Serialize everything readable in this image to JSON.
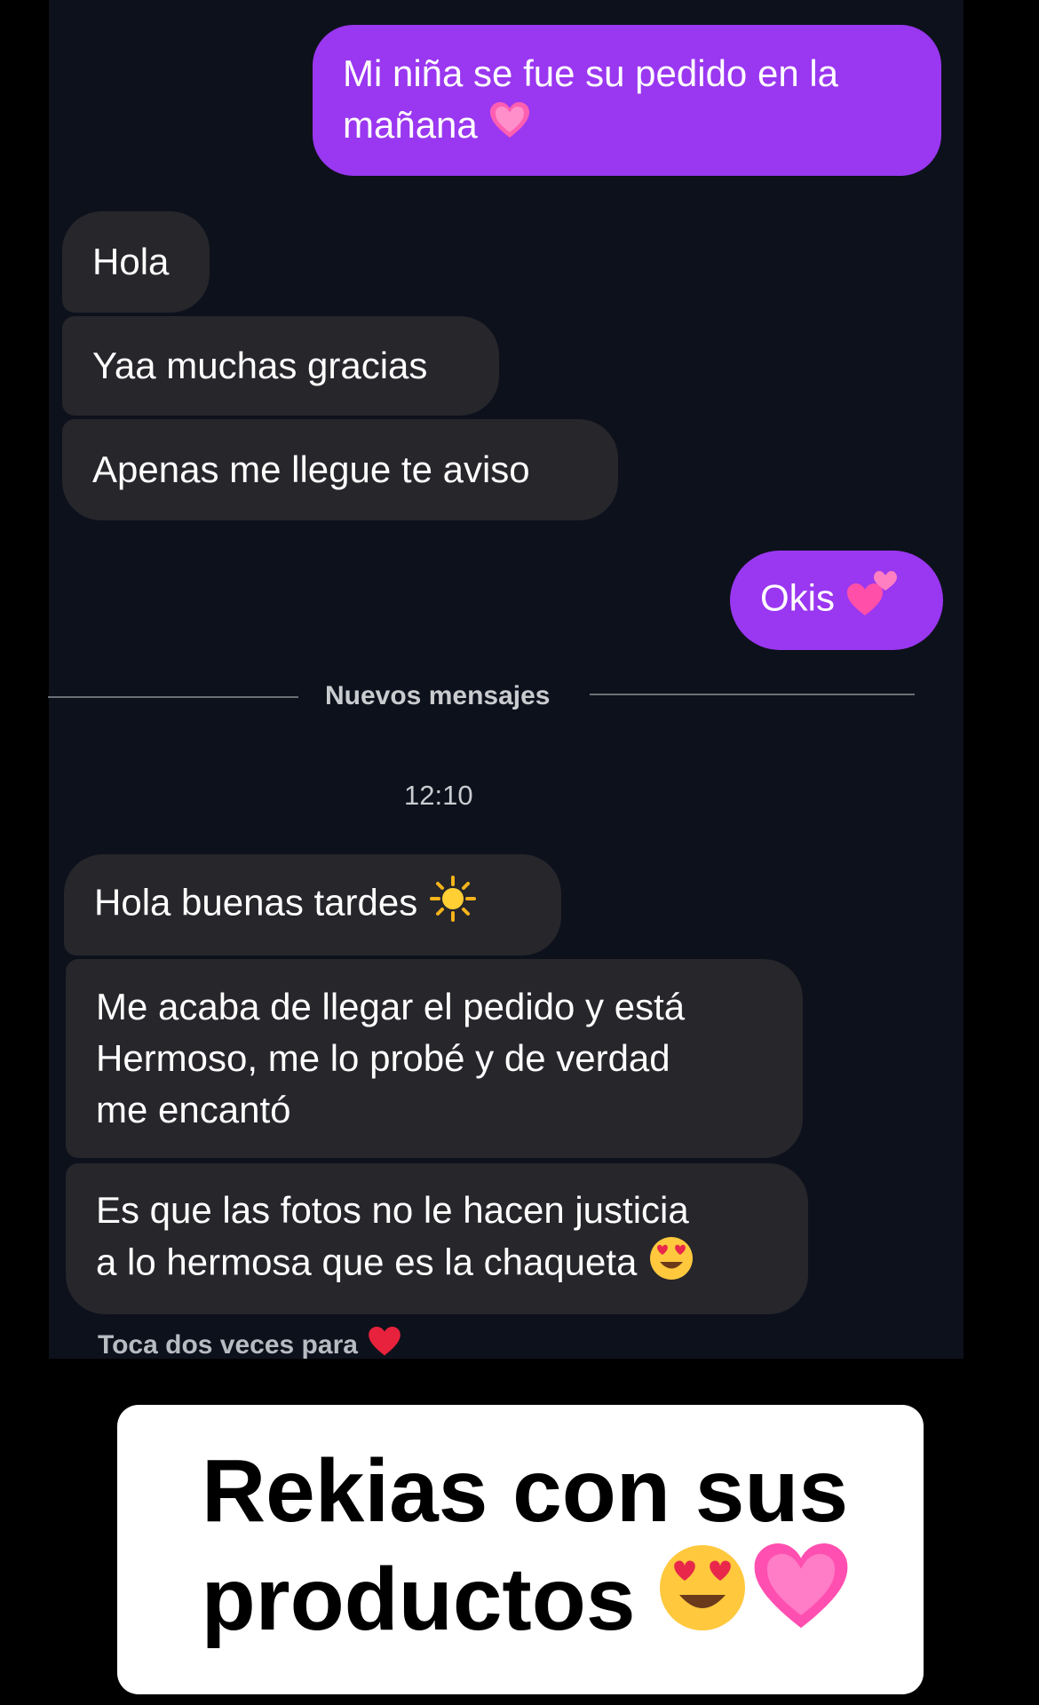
{
  "messages": {
    "sent_1": "Mi niña se fue su pedido en la\nmañana",
    "received_1": "Hola",
    "received_2": "Yaa muchas gracias",
    "received_3": "Apenas me llegue te aviso",
    "sent_2": "Okis",
    "received_4": "Hola buenas tardes",
    "received_5": "Me acaba de llegar el pedido y está\nHermoso, me lo probé y de verdad\nme encantó",
    "received_6": "Es que las fotos no le hacen justicia\na lo hermosa que es la chaqueta"
  },
  "divider": {
    "label": "Nuevos mensajes"
  },
  "timestamp": "12:10",
  "hint": "Toca dos veces para",
  "caption": {
    "line1": "Rekias con sus",
    "line2": "productos"
  },
  "icons": {
    "sent_1": "pink-heart-icon",
    "sent_2": "two-hearts-icon",
    "received_4": "sun-icon",
    "received_6": "heart-eyes-icon",
    "hint": "red-heart-icon",
    "caption": [
      "heart-eyes-icon",
      "pink-heart-icon"
    ]
  },
  "colors": {
    "sent_bubble": "#9a37f0",
    "received_bubble": "#26262b",
    "chat_background": "#0d111c"
  }
}
